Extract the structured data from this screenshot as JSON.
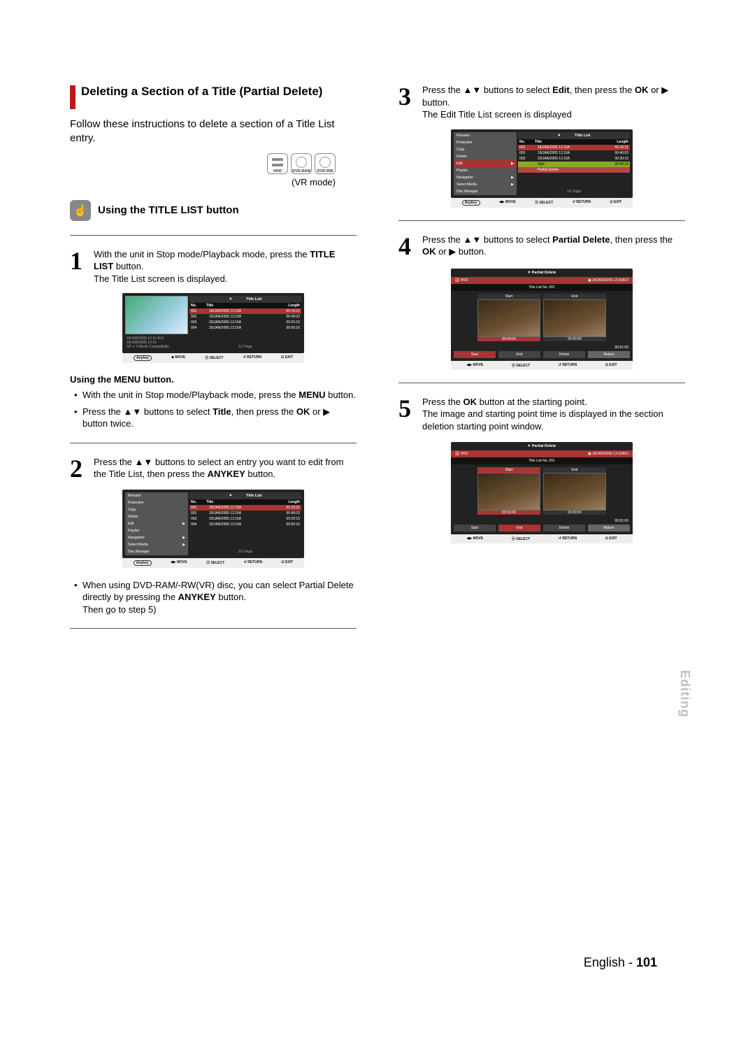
{
  "heading": "Deleting a Section of a Title (Partial Delete)",
  "intro": "Follow these instructions to delete a section of a Title List entry.",
  "media_icons": {
    "hdd": "HDD",
    "ram": "DVD-RAM",
    "rw": "DVD-RW"
  },
  "vr_mode_label": "(VR mode)",
  "subheading": "Using the TITLE LIST button",
  "step1": {
    "num": "1",
    "text_a": "With the unit in Stop mode/Playback mode, press the ",
    "bold_a": "TITLE LIST",
    "text_b": " button.",
    "line2": "The Title List screen is displayed."
  },
  "menu_heading": "Using the MENU button.",
  "menu_b1_a": "With the unit in Stop mode/Playback mode, press the ",
  "menu_b1_bold": "MENU",
  "menu_b1_b": " button.",
  "menu_b2_a": "Press the ▲▼ buttons to select ",
  "menu_b2_bold1": "Title",
  "menu_b2_b": ", then press the ",
  "menu_b2_bold2": "OK",
  "menu_b2_c": " or ▶ button twice.",
  "step2": {
    "num": "2",
    "text_a": "Press the ▲▼ buttons to select an entry you want to edit from the Title List, then press the ",
    "bold_a": "ANYKEY",
    "text_b": " button."
  },
  "ram_note_a": "When using DVD-RAM/-RW(VR) disc, you can select Partial Delete directly by pressing the ",
  "ram_note_bold": "ANYKEY",
  "ram_note_b": " button.",
  "ram_note_c": "Then go to step 5)",
  "step3": {
    "num": "3",
    "text_a": "Press the ▲▼ buttons to select ",
    "bold_a": "Edit",
    "text_b": ", then press the ",
    "bold_b": "OK",
    "text_c": " or ▶ button.",
    "line2": "The Edit Title List screen is displayed"
  },
  "step4": {
    "num": "4",
    "text_a": "Press the ▲▼ buttons to select ",
    "bold_a": "Partial Delete",
    "text_b": ", then press the ",
    "bold_b": "OK",
    "text_c": " or ▶ button."
  },
  "step5": {
    "num": "5",
    "text_a": "Press the ",
    "bold_a": "OK",
    "text_b": " button at the starting point.",
    "line2": "The image and starting point time is displayed in the section deletion starting point window."
  },
  "side_tab": "Editing",
  "footer_lang": "English - ",
  "footer_page": "101",
  "mock_common": {
    "title_list": "Title List",
    "partial_delete": "Partial Delete",
    "hdd": "HDD",
    "col_no": "No.",
    "col_title": "Title",
    "col_length": "Length",
    "page_ind": "1/1 Page",
    "anykey": "Anykey",
    "move": "MOVE",
    "select": "SELECT",
    "return": "RETURN",
    "exit": "EXIT",
    "thumb_meta1": "18/JAN/2005 12:15 AV3",
    "thumb_meta2": "18/JAN/2005 12:15",
    "thumb_meta3": "SP ✔ V-Mode Compatibility"
  },
  "rows": [
    {
      "no": "001",
      "title": "18/JAN/2005 12:15A",
      "len": "00:10:21"
    },
    {
      "no": "002",
      "title": "19/JAN/2005 12:15A",
      "len": "00:40:03"
    },
    {
      "no": "003",
      "title": "20/JAN/2005 12:15A",
      "len": "00:20:15"
    },
    {
      "no": "004",
      "title": "25/JAN/2005 12:15A",
      "len": "00:50:16"
    }
  ],
  "edit_menu": [
    "Rename",
    "Protection",
    "Copy",
    "Delete",
    "Edit",
    "Playlist",
    "Navigation",
    "Select Media",
    "Disc Manager"
  ],
  "edit_submenu": {
    "split": "Split",
    "split_len": "00:50:16",
    "partial": "Partial Delete"
  },
  "pd": {
    "bar_device": "HDD",
    "bar_date": "18/JAN/2005 12:15AV3",
    "list_no_1": "Title List No. 001",
    "start": "Start",
    "end": "End",
    "delete": "Delete",
    "return": "Return",
    "t0": "00:00:00",
    "t1": "00:01:00",
    "prog": "00:01:00"
  }
}
